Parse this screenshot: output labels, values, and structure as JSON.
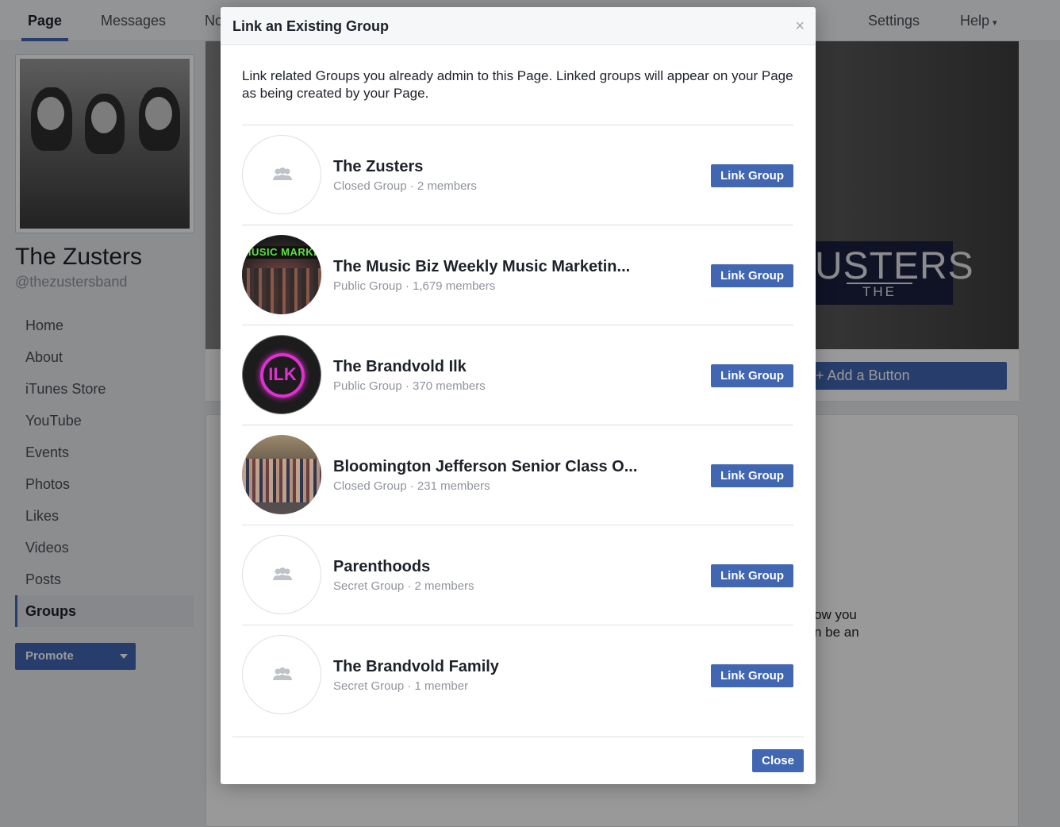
{
  "topnav": {
    "tabs": [
      {
        "label": "Page"
      },
      {
        "label": "Messages"
      },
      {
        "label": "No"
      },
      {
        "label": "Settings"
      },
      {
        "label": "Help"
      }
    ],
    "help_caret": "▾"
  },
  "page": {
    "name": "The Zusters",
    "handle": "@thezustersband",
    "nav": [
      "Home",
      "About",
      "iTunes Store",
      "YouTube",
      "Events",
      "Photos",
      "Likes",
      "Videos",
      "Posts",
      "Groups"
    ],
    "active_nav": "Groups",
    "promote_label": "Promote",
    "add_button_label": "+ Add a Button",
    "cover_logo_big": "USTERS",
    "cover_logo_small": "THE",
    "content_fragment_1": "ow you",
    "content_fragment_2": "n be an"
  },
  "modal": {
    "title": "Link an Existing Group",
    "close_glyph": "×",
    "description": "Link related Groups you already admin to this Page. Linked groups will appear on your Page as being created by your Page.",
    "link_button_label": "Link Group",
    "close_button_label": "Close",
    "groups": [
      {
        "name": "The Zusters",
        "meta": "Closed Group · 2 members",
        "avatar": "placeholder"
      },
      {
        "name": "The Music Biz Weekly Music Marketin...",
        "meta": "Public Group · 1,679 members",
        "avatar": "photo"
      },
      {
        "name": "The Brandvold Ilk",
        "meta": "Public Group · 370 members",
        "avatar": "photo"
      },
      {
        "name": "Bloomington Jefferson Senior Class O...",
        "meta": "Closed Group · 231 members",
        "avatar": "photo"
      },
      {
        "name": "Parenthoods",
        "meta": "Secret Group · 2 members",
        "avatar": "placeholder"
      },
      {
        "name": "The Brandvold Family",
        "meta": "Secret Group · 1 member",
        "avatar": "placeholder"
      }
    ],
    "avatar_text": {
      "music": "MUSIC MARKE",
      "ilk": "ILK"
    }
  },
  "colors": {
    "accent": "#4267b2",
    "text": "#1d2129",
    "muted": "#90949c"
  }
}
